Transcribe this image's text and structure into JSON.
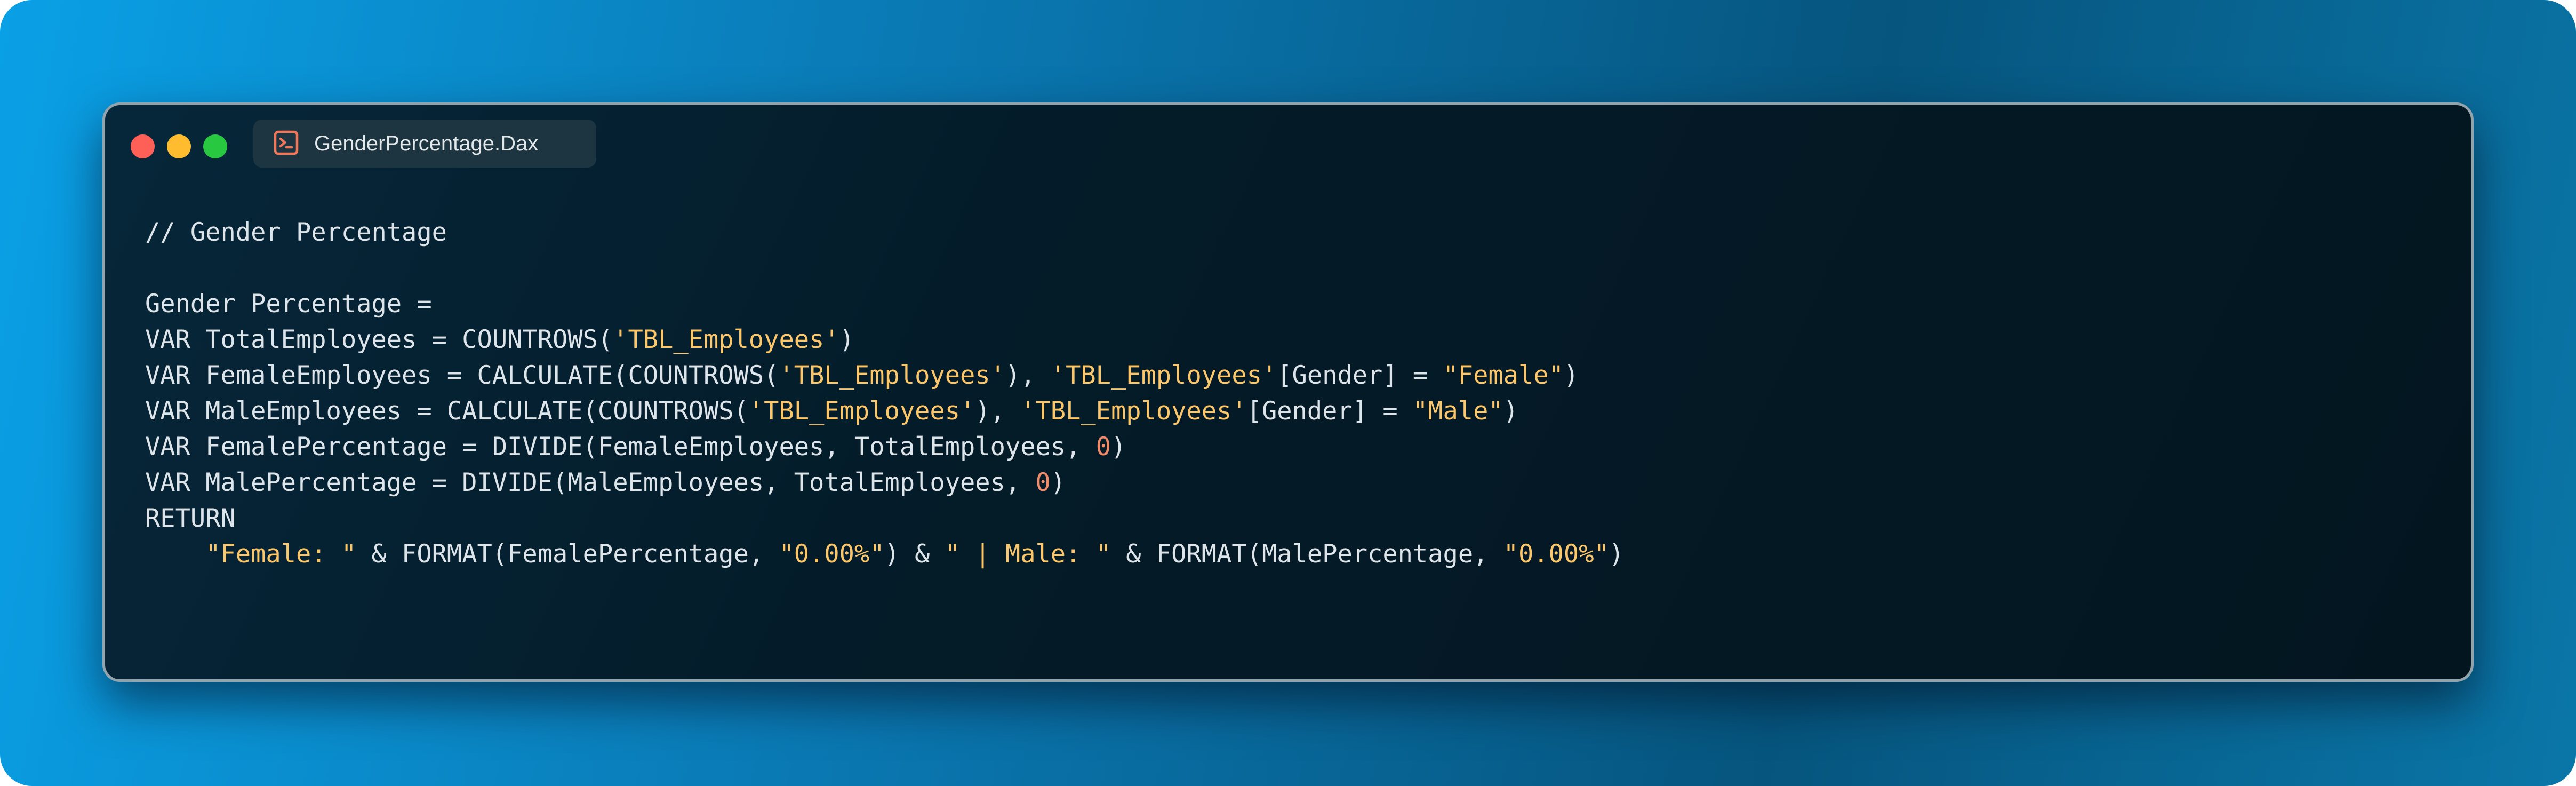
{
  "window": {
    "tab_title": "GenderPercentage.Dax",
    "tab_icon": "terminal-icon",
    "traffic_lights": [
      "close-icon",
      "minimize-icon",
      "maximize-icon"
    ]
  },
  "colors": {
    "code_text": "#dee5ea",
    "string": "#fcc66b",
    "number": "#f28b6a",
    "close": "#fe5f57",
    "minimize": "#febc2e",
    "maximize": "#28c840"
  },
  "code": {
    "lines": [
      [
        {
          "t": "// Gender Percentage"
        }
      ],
      [],
      [
        {
          "t": "Gender Percentage ="
        }
      ],
      [
        {
          "t": "VAR TotalEmployees = COUNTROWS("
        },
        {
          "t": "'TBL_Employees'",
          "c": "str"
        },
        {
          "t": ")"
        }
      ],
      [
        {
          "t": "VAR FemaleEmployees = CALCULATE(COUNTROWS("
        },
        {
          "t": "'TBL_Employees'",
          "c": "str"
        },
        {
          "t": "), "
        },
        {
          "t": "'TBL_Employees'",
          "c": "str"
        },
        {
          "t": "[Gender] = "
        },
        {
          "t": "\"Female\"",
          "c": "str"
        },
        {
          "t": ")"
        }
      ],
      [
        {
          "t": "VAR MaleEmployees = CALCULATE(COUNTROWS("
        },
        {
          "t": "'TBL_Employees'",
          "c": "str"
        },
        {
          "t": "), "
        },
        {
          "t": "'TBL_Employees'",
          "c": "str"
        },
        {
          "t": "[Gender] = "
        },
        {
          "t": "\"Male\"",
          "c": "str"
        },
        {
          "t": ")"
        }
      ],
      [
        {
          "t": "VAR FemalePercentage = DIVIDE(FemaleEmployees, TotalEmployees, "
        },
        {
          "t": "0",
          "c": "num"
        },
        {
          "t": ")"
        }
      ],
      [
        {
          "t": "VAR MalePercentage = DIVIDE(MaleEmployees, TotalEmployees, "
        },
        {
          "t": "0",
          "c": "num"
        },
        {
          "t": ")"
        }
      ],
      [
        {
          "t": "RETURN"
        }
      ],
      [
        {
          "t": "    "
        },
        {
          "t": "\"Female: \"",
          "c": "str"
        },
        {
          "t": " & FORMAT(FemalePercentage, "
        },
        {
          "t": "\"0.00%\"",
          "c": "str"
        },
        {
          "t": ") & "
        },
        {
          "t": "\" | Male: \"",
          "c": "str"
        },
        {
          "t": " & FORMAT(MalePercentage, "
        },
        {
          "t": "\"0.00%\"",
          "c": "str"
        },
        {
          "t": ")"
        }
      ]
    ]
  }
}
